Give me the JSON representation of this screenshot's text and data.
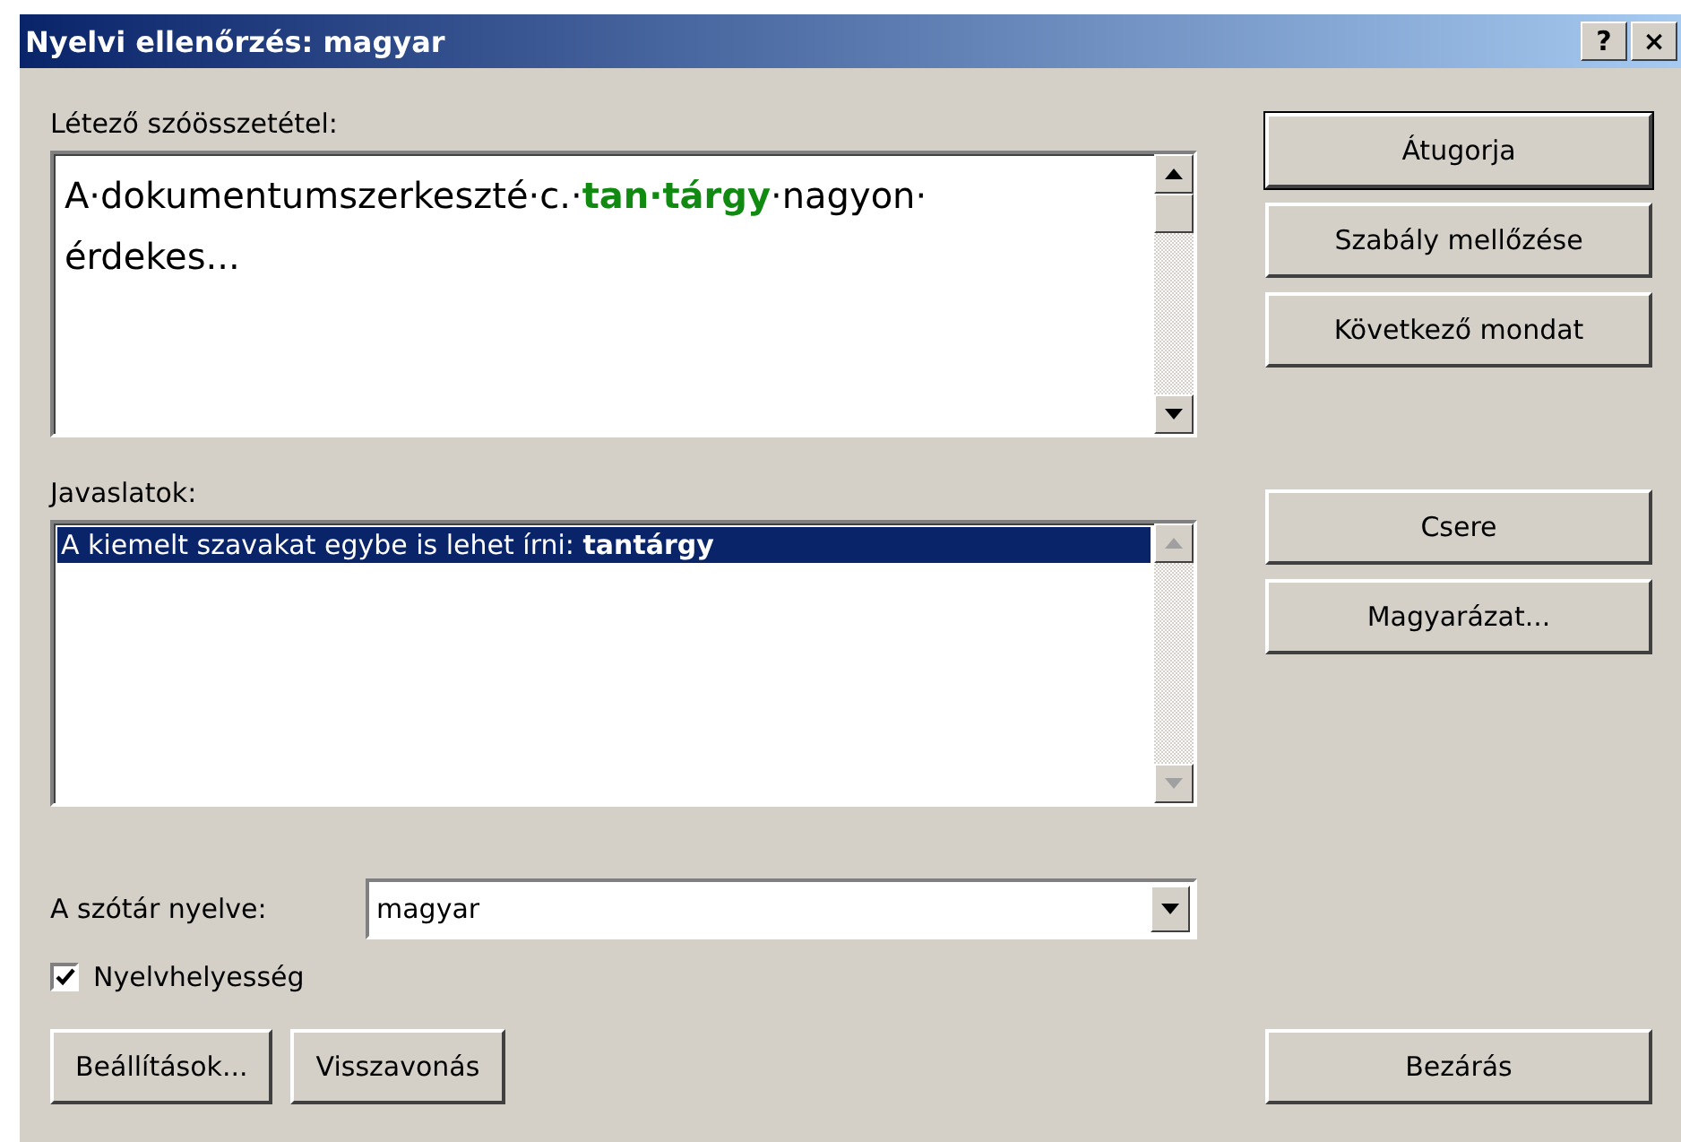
{
  "window": {
    "title": "Nyelvi ellenőrzés: magyar",
    "help": "?",
    "close": "×"
  },
  "compound": {
    "label": "Létező szóösszetétel:",
    "text_before": "A·dokumentumszerkeszté·c.·",
    "highlight": "tan·tárgy",
    "text_after": "·nagyon·",
    "line_2": "érdekes..."
  },
  "suggestions": {
    "label": "Javaslatok:",
    "items": [
      {
        "text": "A kiemelt szavakat egybe is lehet írni: **tantárgy**",
        "selected": true
      }
    ]
  },
  "dictionary": {
    "label": "A szótár nyelve:",
    "value": "magyar"
  },
  "grammar_check": {
    "label": "Nyelvhelyesség",
    "checked": true
  },
  "side_buttons_top": [
    "Átugorja",
    "Szabály mellőzése",
    "Következő mondat"
  ],
  "side_buttons_bottom": [
    "Csere",
    "Magyarázat..."
  ],
  "bottom_buttons": [
    "Beállítások...",
    "Visszavonás"
  ],
  "close_button": "Bezárás"
}
